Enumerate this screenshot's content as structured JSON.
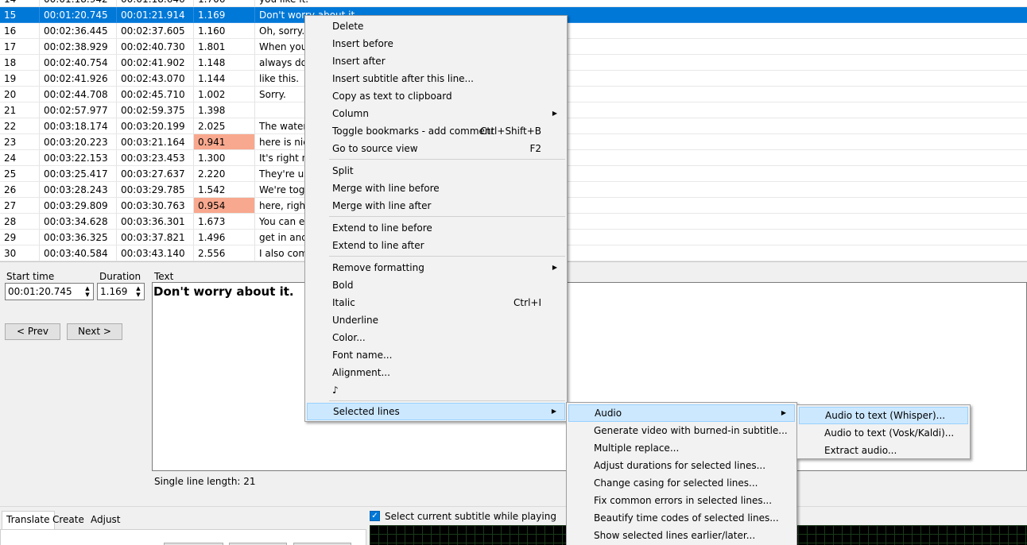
{
  "grid": {
    "rows": [
      {
        "num": "14",
        "start": "00:01:18.942",
        "end": "00:01:18.646",
        "dur": "1.706",
        "text": "you like it."
      },
      {
        "num": "15",
        "start": "00:01:20.745",
        "end": "00:01:21.914",
        "dur": "1.169",
        "text": "Don't worry about it."
      },
      {
        "num": "16",
        "start": "00:02:36.445",
        "end": "00:02:37.605",
        "dur": "1.160",
        "text": "Oh, sorry."
      },
      {
        "num": "17",
        "start": "00:02:38.929",
        "end": "00:02:40.730",
        "dur": "1.801",
        "text": "When you"
      },
      {
        "num": "18",
        "start": "00:02:40.754",
        "end": "00:02:41.902",
        "dur": "1.148",
        "text": "always do"
      },
      {
        "num": "19",
        "start": "00:02:41.926",
        "end": "00:02:43.070",
        "dur": "1.144",
        "text": "like this."
      },
      {
        "num": "20",
        "start": "00:02:44.708",
        "end": "00:02:45.710",
        "dur": "1.002",
        "text": "Sorry."
      },
      {
        "num": "21",
        "start": "00:02:57.977",
        "end": "00:02:59.375",
        "dur": "1.398",
        "text": ""
      },
      {
        "num": "22",
        "start": "00:03:18.174",
        "end": "00:03:20.199",
        "dur": "2.025",
        "text": "The water"
      },
      {
        "num": "23",
        "start": "00:03:20.223",
        "end": "00:03:21.164",
        "dur": "0.941",
        "text": "here is nic"
      },
      {
        "num": "24",
        "start": "00:03:22.153",
        "end": "00:03:23.453",
        "dur": "1.300",
        "text": "It's right n"
      },
      {
        "num": "25",
        "start": "00:03:25.417",
        "end": "00:03:27.637",
        "dur": "2.220",
        "text": "They're us"
      },
      {
        "num": "26",
        "start": "00:03:28.243",
        "end": "00:03:29.785",
        "dur": "1.542",
        "text": "We're tog"
      },
      {
        "num": "27",
        "start": "00:03:29.809",
        "end": "00:03:30.763",
        "dur": "0.954",
        "text": "here, righ"
      },
      {
        "num": "28",
        "start": "00:03:34.628",
        "end": "00:03:36.301",
        "dur": "1.673",
        "text": "You can e"
      },
      {
        "num": "29",
        "start": "00:03:36.325",
        "end": "00:03:37.821",
        "dur": "1.496",
        "text": "get in and"
      },
      {
        "num": "30",
        "start": "00:03:40.584",
        "end": "00:03:43.140",
        "dur": "2.556",
        "text": "I also com"
      }
    ]
  },
  "edit": {
    "start_label": "Start time",
    "duration_label": "Duration",
    "text_label": "Text",
    "start_value": "00:01:20.745",
    "duration_value": "1.169",
    "prev_label": "< Prev",
    "next_label": "Next >",
    "text_value": "Don't worry about it.",
    "line_length": "Single line length: 21"
  },
  "bottom": {
    "tabs": [
      "Translate",
      "Create",
      "Adjust"
    ],
    "select_current": "Select current subtitle while playing"
  },
  "menu_main": {
    "items": [
      {
        "label": "Delete"
      },
      {
        "label": "Insert before"
      },
      {
        "label": "Insert after"
      },
      {
        "label": "Insert subtitle after this line..."
      },
      {
        "label": "Copy as text to clipboard"
      },
      {
        "label": "Column",
        "submenu": true
      },
      {
        "label": "Toggle bookmarks - add comment",
        "shortcut": "Ctrl+Shift+B"
      },
      {
        "label": "Go to source view",
        "shortcut": "F2"
      },
      {
        "label": "Split"
      },
      {
        "label": "Merge with line before"
      },
      {
        "label": "Merge with line after"
      },
      {
        "label": "Extend to line before"
      },
      {
        "label": "Extend to line after"
      },
      {
        "label": "Remove formatting",
        "submenu": true
      },
      {
        "label": "Bold"
      },
      {
        "label": "Italic",
        "shortcut": "Ctrl+I"
      },
      {
        "label": "Underline"
      },
      {
        "label": "Color..."
      },
      {
        "label": "Font name..."
      },
      {
        "label": "Alignment..."
      },
      {
        "label": "♪"
      },
      {
        "label": "Selected lines",
        "submenu": true
      }
    ]
  },
  "menu_selected": {
    "items": [
      {
        "label": "Audio",
        "submenu": true
      },
      {
        "label": "Generate video with burned-in subtitle..."
      },
      {
        "label": "Multiple replace..."
      },
      {
        "label": "Adjust durations for selected lines..."
      },
      {
        "label": "Change casing for selected lines..."
      },
      {
        "label": "Fix common errors in selected lines..."
      },
      {
        "label": "Beautify time codes of selected lines..."
      },
      {
        "label": "Show selected lines earlier/later..."
      }
    ]
  },
  "menu_audio": {
    "items": [
      {
        "label": "Audio to text (Whisper)..."
      },
      {
        "label": "Audio to text (Vosk/Kaldi)..."
      },
      {
        "label": "Extract audio..."
      }
    ]
  },
  "colors": {
    "selection": "#0078d7",
    "warning": "#f8a88e",
    "menu_highlight": "#cce8ff"
  }
}
